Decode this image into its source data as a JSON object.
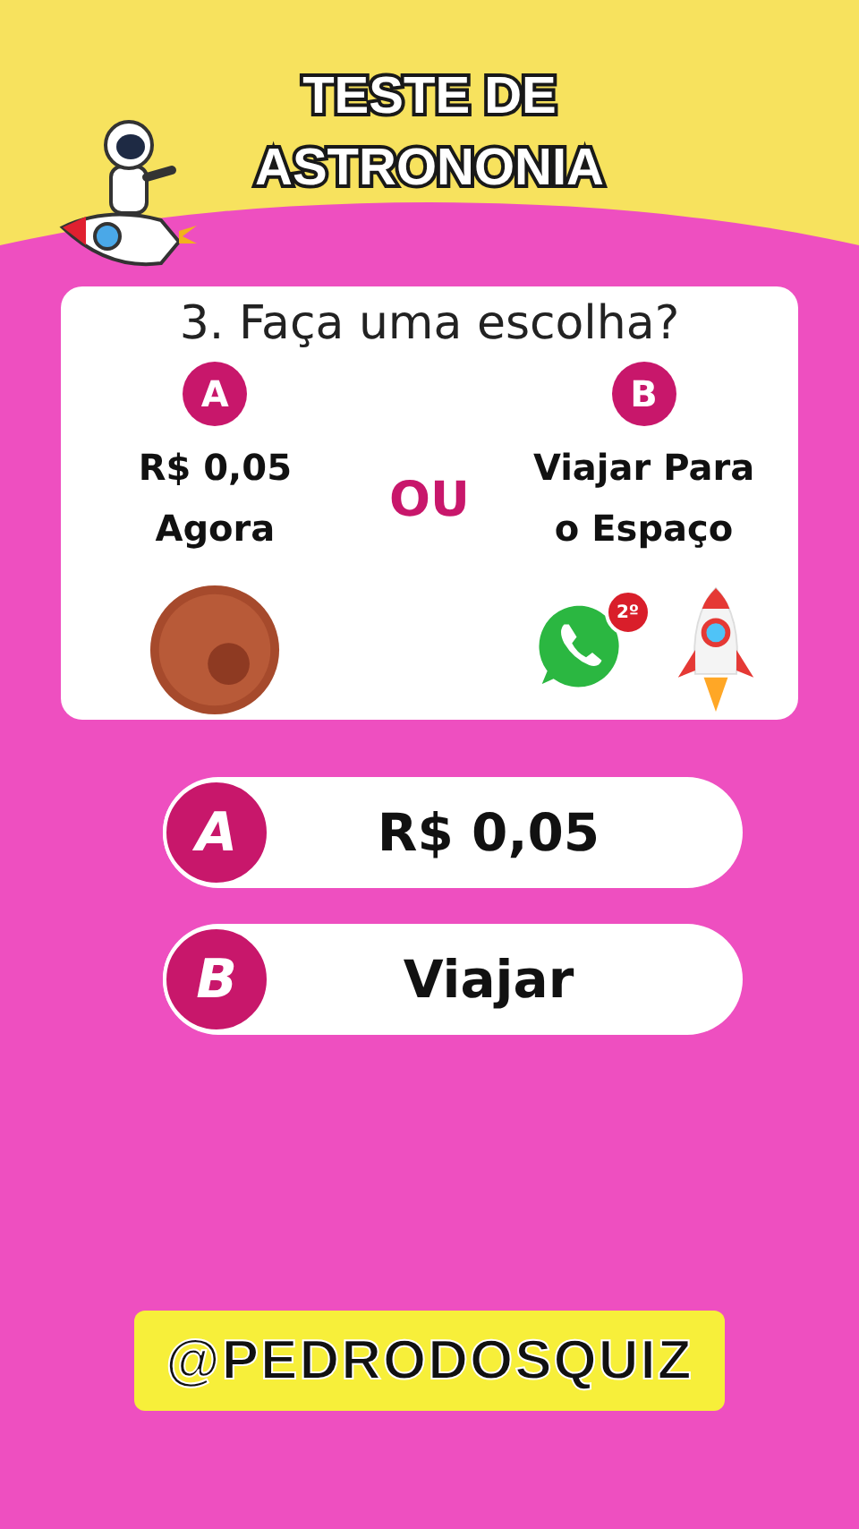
{
  "title": [
    "TESTE DE",
    "ASTRONONIA"
  ],
  "question": "3. Faça uma escolha?",
  "options": [
    {
      "letter": "A",
      "label": [
        "R$ 0,05",
        "Agora"
      ],
      "pictures": [
        {
          "kind": "coin"
        }
      ]
    },
    {
      "letter": "B",
      "label": [
        "Viajar Para",
        "o Espaço"
      ],
      "pictures": [
        {
          "kind": "chat",
          "badge": "2º"
        },
        {
          "kind": "rocket"
        }
      ]
    }
  ],
  "separator": "OU",
  "answers": [
    {
      "letter": "A",
      "text": "R$ 0,05"
    },
    {
      "letter": "B",
      "text": "Viajar"
    }
  ],
  "handle": "@PEDRODOSQUIZ"
}
